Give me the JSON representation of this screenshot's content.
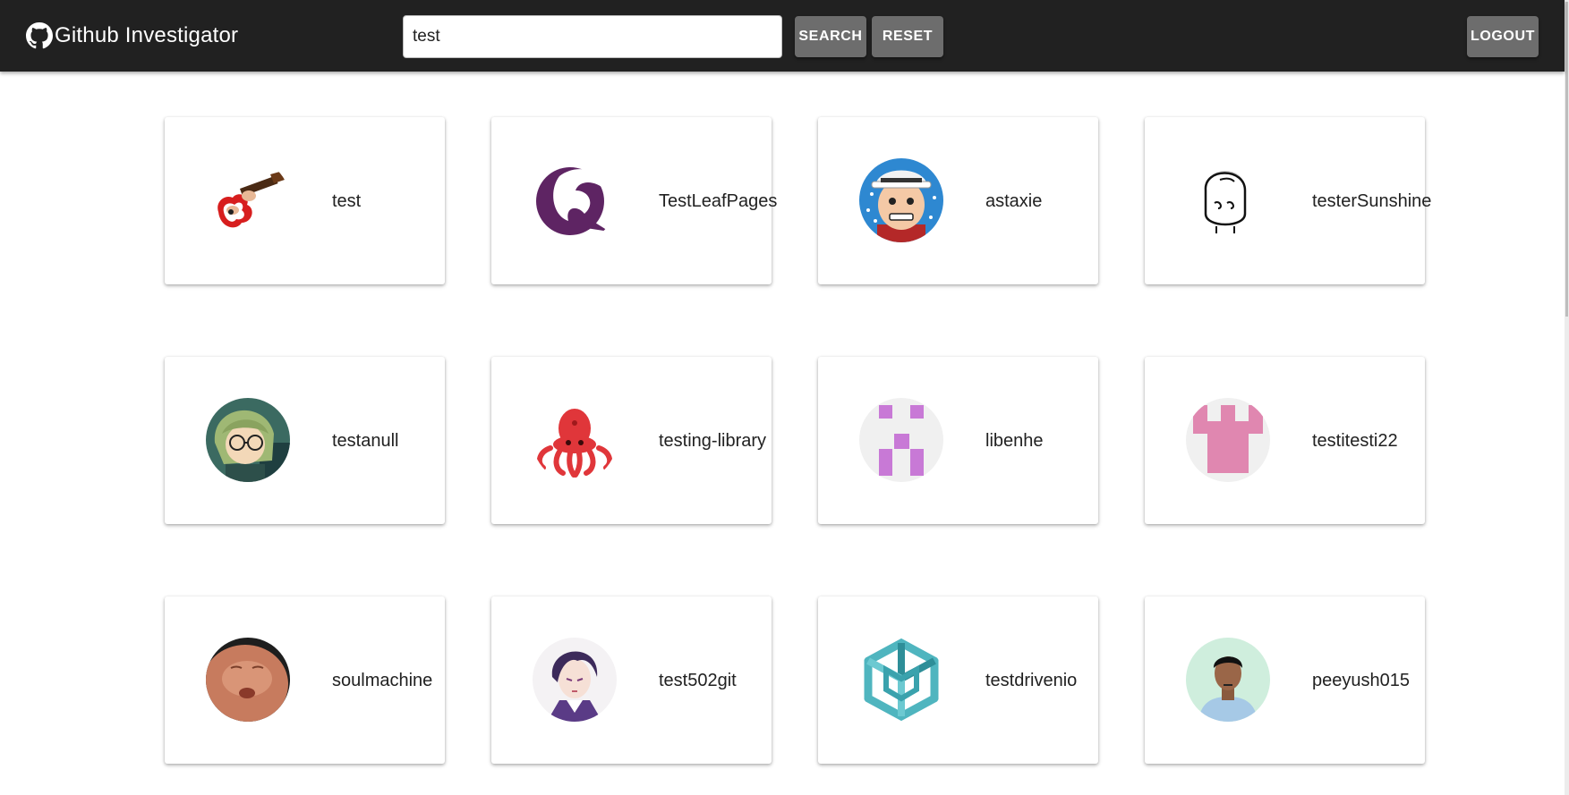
{
  "app": {
    "title": "Github Investigator",
    "logo_icon": "github-icon"
  },
  "search": {
    "value": "test",
    "search_label": "SEARCH",
    "reset_label": "RESET"
  },
  "logout_label": "LOGOUT",
  "colors": {
    "appbar": "#212121",
    "button": "#6d6d6d"
  },
  "users": [
    {
      "login": "test",
      "avatar": "guitar-avatar"
    },
    {
      "login": "TestLeafPages",
      "avatar": "purple-wave-avatar"
    },
    {
      "login": "astaxie",
      "avatar": "cartoon-face-avatar"
    },
    {
      "login": "testerSunshine",
      "avatar": "meme-face-avatar"
    },
    {
      "login": "testanull",
      "avatar": "anime-girl-avatar"
    },
    {
      "login": "testing-library",
      "avatar": "octopus-avatar"
    },
    {
      "login": "libenhe",
      "avatar": "identicon-violet-avatar"
    },
    {
      "login": "testitesti22",
      "avatar": "identicon-pink-avatar"
    },
    {
      "login": "soulmachine",
      "avatar": "baby-photo-avatar"
    },
    {
      "login": "test502git",
      "avatar": "anime-boy-avatar"
    },
    {
      "login": "testdrivenio",
      "avatar": "cube-logo-avatar"
    },
    {
      "login": "peeyush015",
      "avatar": "person-photo-avatar"
    }
  ]
}
